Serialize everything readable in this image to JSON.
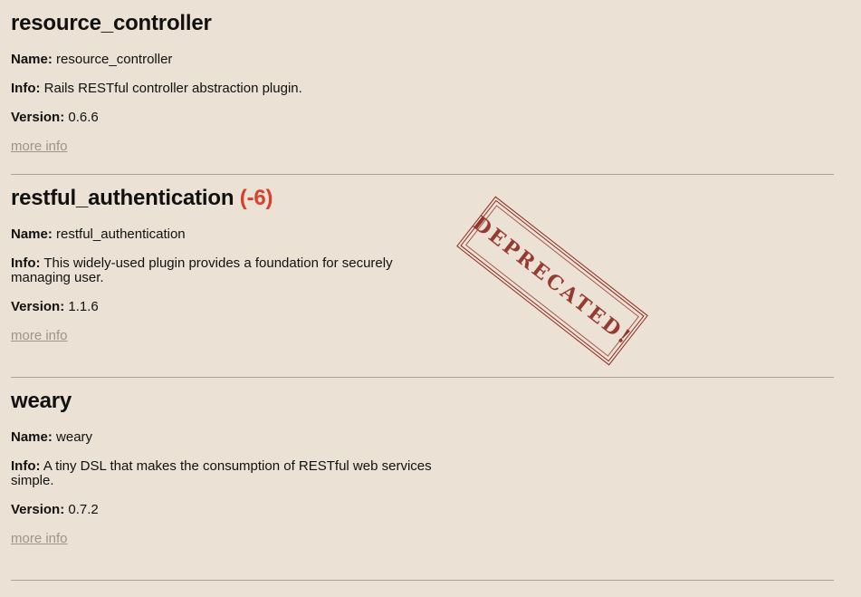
{
  "plugins": [
    {
      "title": "resource_controller",
      "delta": "",
      "name_label": "Name:",
      "name": "resource_controller",
      "info_label": "Info:",
      "info": "Rails RESTful controller abstraction plugin.",
      "version_label": "Version:",
      "version": "0.6.6",
      "more_info": "more info"
    },
    {
      "title": "restful_authentication",
      "delta": "(-6)",
      "name_label": "Name:",
      "name": "restful_authentication",
      "info_label": "Info:",
      "info": "This widely-used plugin provides a foundation for securely managing user.",
      "version_label": "Version:",
      "version": "1.1.6",
      "more_info": "more info"
    },
    {
      "title": "weary",
      "delta": "",
      "name_label": "Name:",
      "name": "weary",
      "info_label": "Info:",
      "info": "A tiny DSL that makes the consumption of RESTful web services simple.",
      "version_label": "Version:",
      "version": "0.7.2",
      "more_info": "more info"
    }
  ],
  "stamp": {
    "text": "Deprecated!",
    "color": "#8d2a20"
  },
  "colors": {
    "background": "#ebe1d4",
    "delta": "#d9402b",
    "link": "#a09488"
  }
}
